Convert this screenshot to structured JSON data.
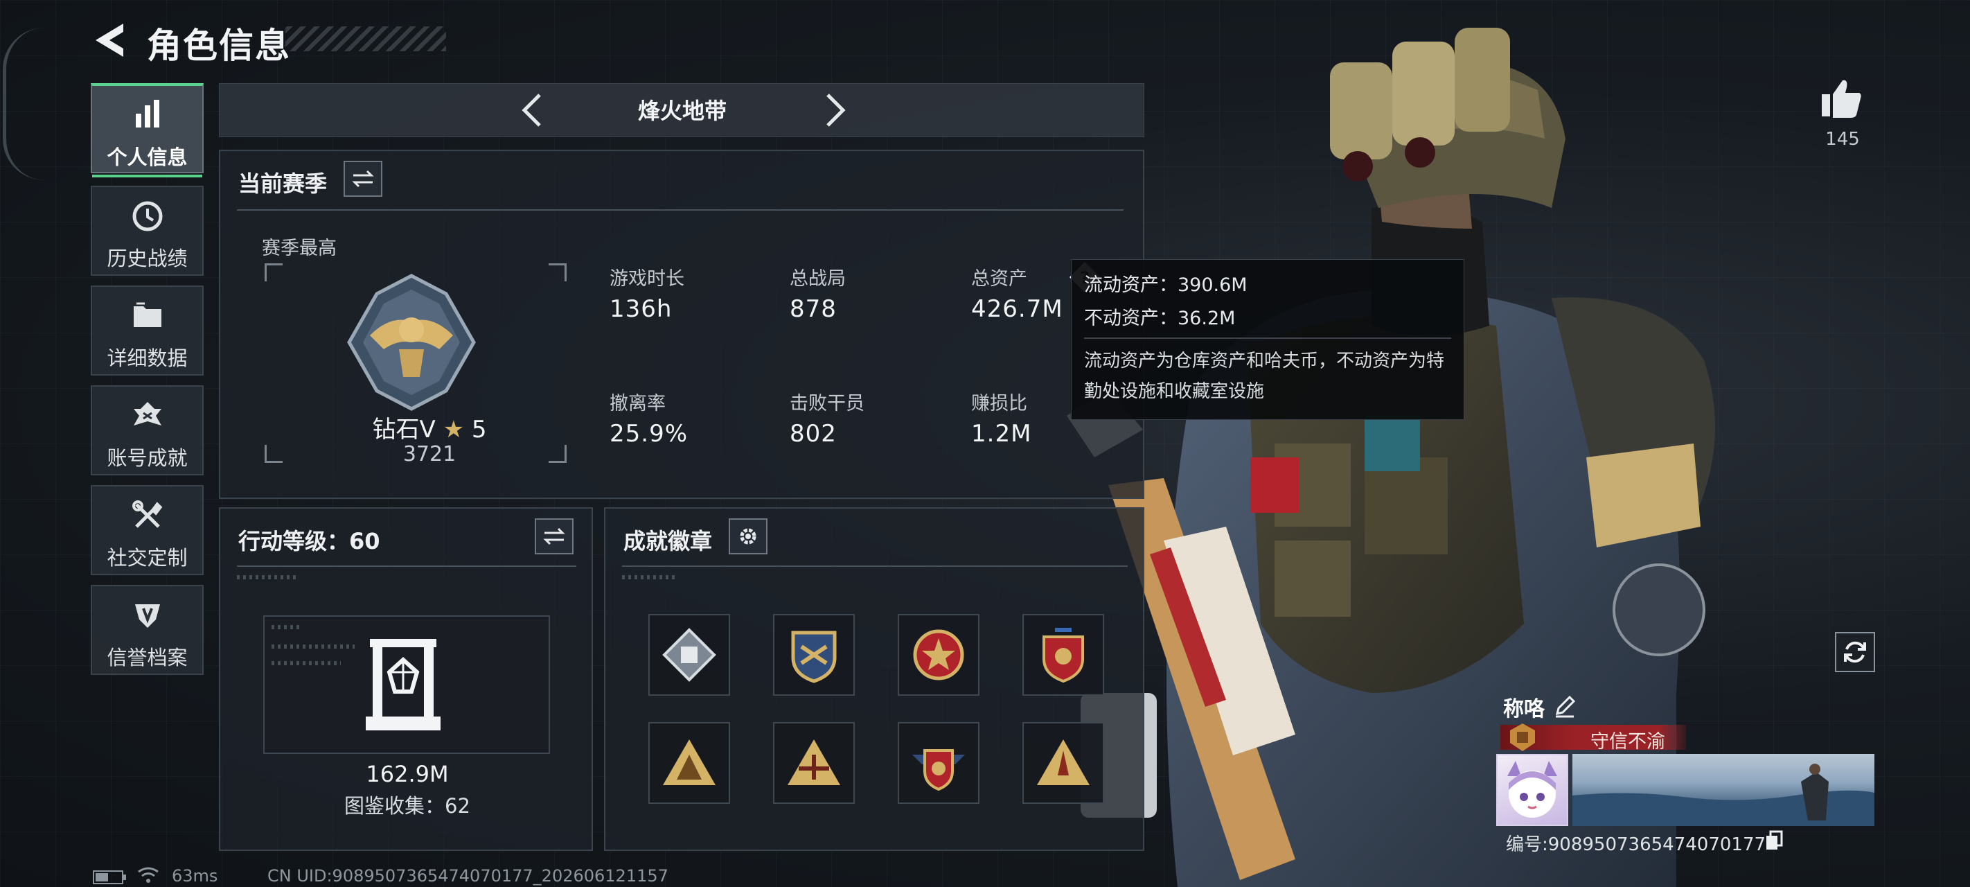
{
  "header": {
    "title": "角色信息"
  },
  "nav": [
    {
      "label": "个人信息",
      "icon": "bar-chart-icon",
      "active": true
    },
    {
      "label": "历史战绩",
      "icon": "clock-history-icon",
      "active": false
    },
    {
      "label": "详细数据",
      "icon": "folder-icon",
      "active": false
    },
    {
      "label": "账号成就",
      "icon": "achievement-icon",
      "active": false
    },
    {
      "label": "社交定制",
      "icon": "tools-icon",
      "active": false
    },
    {
      "label": "信誉档案",
      "icon": "credit-shield-icon",
      "active": false
    }
  ],
  "mode": {
    "title": "烽火地带"
  },
  "season": {
    "title": "当前赛季",
    "best_label": "赛季最高",
    "rank_name": "钻石V",
    "rank_stars": "5",
    "rank_score": "3721",
    "stats": [
      {
        "label": "游戏时长",
        "value": "136h"
      },
      {
        "label": "总战局",
        "value": "878"
      },
      {
        "label": "总资产",
        "value": "426.7M"
      },
      {
        "label": "撤离率",
        "value": "25.9%"
      },
      {
        "label": "击败干员",
        "value": "802"
      },
      {
        "label": "赚损比",
        "value": "1.2M"
      }
    ]
  },
  "tooltip": {
    "liquid": "流动资产：390.6M",
    "fixed": "不动资产：36.2M",
    "note": "流动资产为仓库资产和哈夫币，不动资产为特勤处设施和收藏室设施"
  },
  "action_level": {
    "title": "行动等级：60",
    "value": "162.9M",
    "collection": "图鉴收集：62"
  },
  "badges": {
    "title": "成就徽章",
    "items": [
      "badge-diamond-icon",
      "badge-gold-shield-icon",
      "badge-red-star-icon",
      "badge-red-crest-icon",
      "badge-triangle-team-icon",
      "badge-triangle-aircraft-icon",
      "badge-winged-shield-icon",
      "badge-triangle-rocket-icon"
    ]
  },
  "likes": {
    "count": "145"
  },
  "profile": {
    "nickname_label": "称咯",
    "title_tag": "守信不渝",
    "id_text": "编号:9089507365474070177"
  },
  "footer": {
    "ping": "63ms",
    "uid": "CN UID:9089507365474070177_202606121157"
  },
  "colors": {
    "accent_green": "#5bd28e",
    "gold": "#d4b266",
    "title_red": "#9a2226"
  }
}
